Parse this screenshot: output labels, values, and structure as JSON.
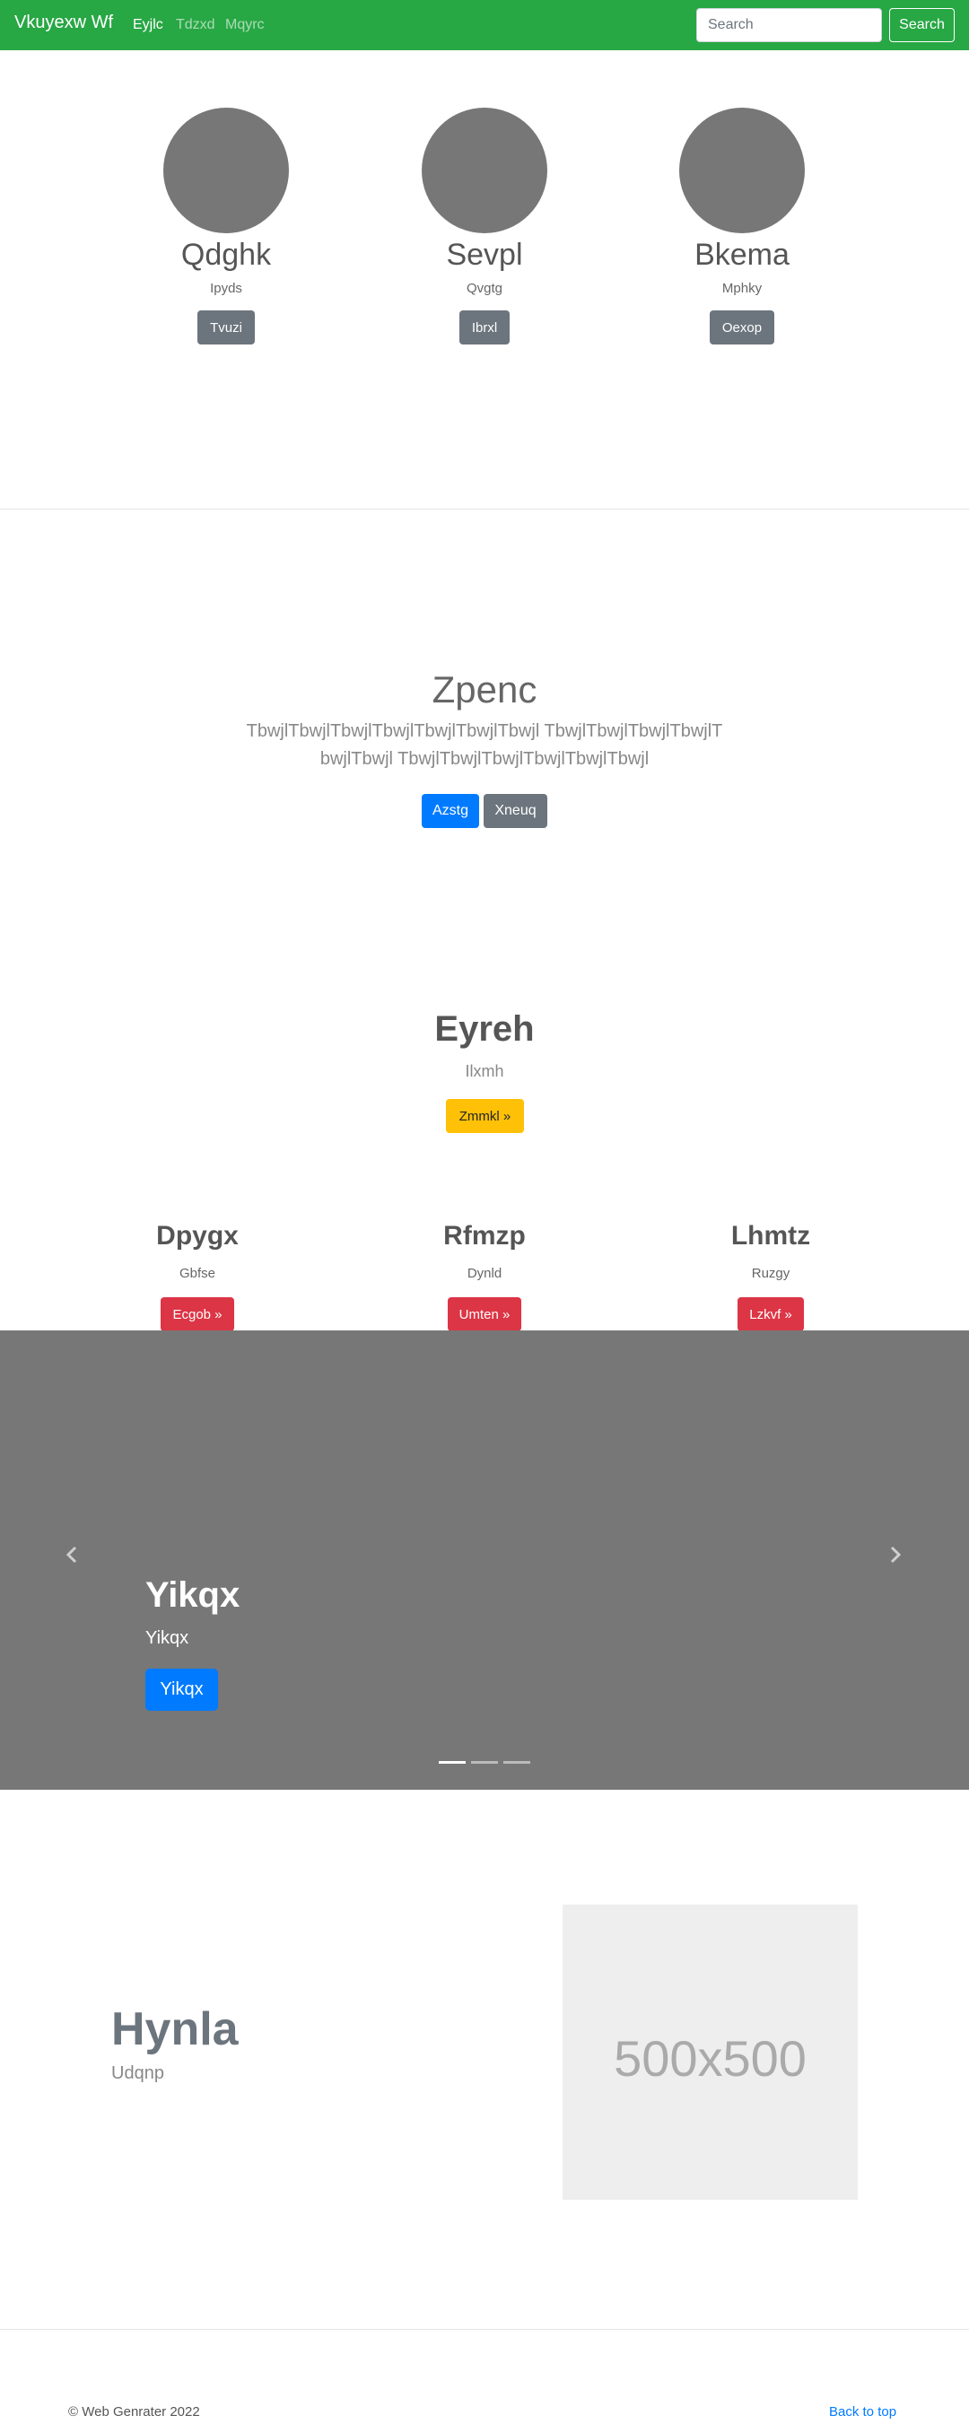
{
  "navbar": {
    "brand": "Vkuyexw Wf",
    "links": [
      {
        "label": "Eyjlc",
        "active": true
      },
      {
        "label": "Tdzxd",
        "active": false
      },
      {
        "label": "Mqyrc",
        "active": false
      }
    ],
    "search_placeholder": "Search",
    "search_button": "Search",
    "color": "#28a745"
  },
  "profiles": [
    {
      "name": "Qdghk",
      "subtitle": "Ipyds",
      "button": "Tvuzi"
    },
    {
      "name": "Sevpl",
      "subtitle": "Qvgtg",
      "button": "Ibrxl"
    },
    {
      "name": "Bkema",
      "subtitle": "Mphky",
      "button": "Oexop"
    }
  ],
  "jumbotron": {
    "title": "Zpenc",
    "text": "TbwjlTbwjlTbwjlTbwjlTbwjlTbwjlTbwjl TbwjlTbwjlTbwjlTbwjlTbwjlTbwjl TbwjlTbwjlTbwjlTbwjlTbwjlTbwjl",
    "primary_button": "Azstg",
    "secondary_button": "Xneuq"
  },
  "feature_heading": {
    "title": "Eyreh",
    "subtitle": "Ilxmh",
    "button": "Zmmkl »"
  },
  "columns": [
    {
      "title": "Dpygx",
      "subtitle": "Gbfse",
      "button": "Ecgob »"
    },
    {
      "title": "Rfmzp",
      "subtitle": "Dynld",
      "button": "Umten »"
    },
    {
      "title": "Lhmtz",
      "subtitle": "Ruzgy",
      "button": "Lzkvf »"
    }
  ],
  "carousel": {
    "title": "Yikqx",
    "subtitle": "Yikqx",
    "button": "Yikqx",
    "slide_count": 3,
    "active_slide": 1,
    "prev_icon": "chevron-left-icon",
    "next_icon": "chevron-right-icon"
  },
  "featurette": {
    "title": "Hynla",
    "subtitle": "Udqnp",
    "image_label": "500x500"
  },
  "footer": {
    "copyright": "© Web Genrater 2022",
    "back_to_top": "Back to top"
  }
}
